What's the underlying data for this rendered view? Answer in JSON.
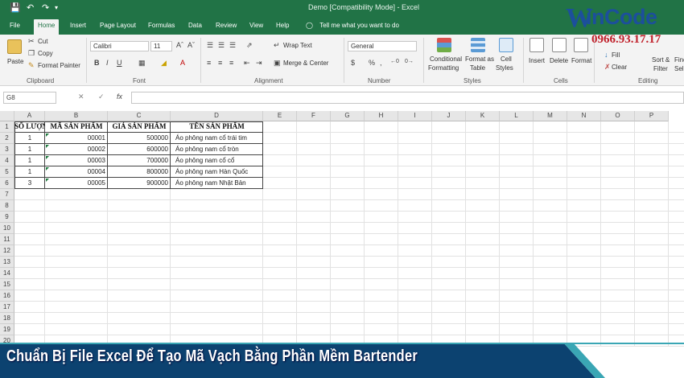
{
  "window": {
    "title": "Demo [Compatibility Mode] - Excel",
    "colors": {
      "accent": "#217346",
      "banner": "#0c4270",
      "banner_edge": "#3aa6b4",
      "logo_blue": "#1c4f9c",
      "logo_red": "#c0202a"
    }
  },
  "tabs": [
    "File",
    "Home",
    "Insert",
    "Page Layout",
    "Formulas",
    "Data",
    "Review",
    "View",
    "Help"
  ],
  "active_tab": "Home",
  "tell_me": "Tell me what you want to do",
  "ribbon": {
    "clipboard": {
      "paste": "Paste",
      "cut": "Cut",
      "copy": "Copy",
      "format_painter": "Format Painter",
      "label": "Clipboard"
    },
    "font": {
      "name": "Calibri",
      "size": "11",
      "label": "Font"
    },
    "alignment": {
      "wrap_text": "Wrap Text",
      "merge_center": "Merge & Center",
      "label": "Alignment"
    },
    "number": {
      "format": "General",
      "label": "Number"
    },
    "styles": {
      "conditional_1": "Conditional",
      "conditional_2": "Formatting",
      "format_as_1": "Format as",
      "format_as_2": "Table",
      "cell_1": "Cell",
      "cell_2": "Styles",
      "label": "Styles"
    },
    "cells": {
      "insert": "Insert",
      "delete": "Delete",
      "format": "Format",
      "label": "Cells"
    },
    "editing": {
      "fill": "Fill",
      "clear": "Clear",
      "sort_1": "Sort &",
      "sort_2": "Filter",
      "find_1": "Find",
      "find_2": "Selec",
      "label": "Editing"
    }
  },
  "formula_bar": {
    "name_box": "G8",
    "fx": "fx"
  },
  "sheet": {
    "columns": [
      "A",
      "B",
      "C",
      "D",
      "E",
      "F",
      "G",
      "H",
      "I",
      "J",
      "K",
      "L",
      "M",
      "N",
      "O",
      "P"
    ],
    "rows": [
      "1",
      "2",
      "3",
      "4",
      "5",
      "6",
      "7",
      "8",
      "9",
      "10",
      "11",
      "12",
      "13",
      "14",
      "15",
      "16",
      "17",
      "18",
      "19",
      "20"
    ],
    "headers": [
      "SỐ LƯỢNG",
      "MÃ SẢN PHẨM",
      "GIÁ SẢN PHẨM",
      "TÊN SẢN PHẨM"
    ],
    "data": [
      [
        "1",
        "00001",
        "500000",
        "Áo phông nam cổ trái tim"
      ],
      [
        "1",
        "00002",
        "600000",
        "Áo phông nam cổ tròn"
      ],
      [
        "1",
        "00003",
        "700000",
        "Áo phông nam cổ cổ"
      ],
      [
        "1",
        "00004",
        "800000",
        "Áo phông nam Hàn Quốc"
      ],
      [
        "3",
        "00005",
        "900000",
        "Áo phông nam Nhật Bản"
      ]
    ]
  },
  "banner": {
    "title": "Chuẩn Bị File Excel Để Tạo Mã Vạch Bằng Phần Mềm Bartender"
  },
  "logo": {
    "brand_rest": "inCode",
    "phone": "0966.93.17.17"
  },
  "icons": [
    "save-icon",
    "undo-icon",
    "redo-icon",
    "lightbulb-icon",
    "cut-icon",
    "copy-icon",
    "format-painter-icon",
    "paste-icon"
  ]
}
